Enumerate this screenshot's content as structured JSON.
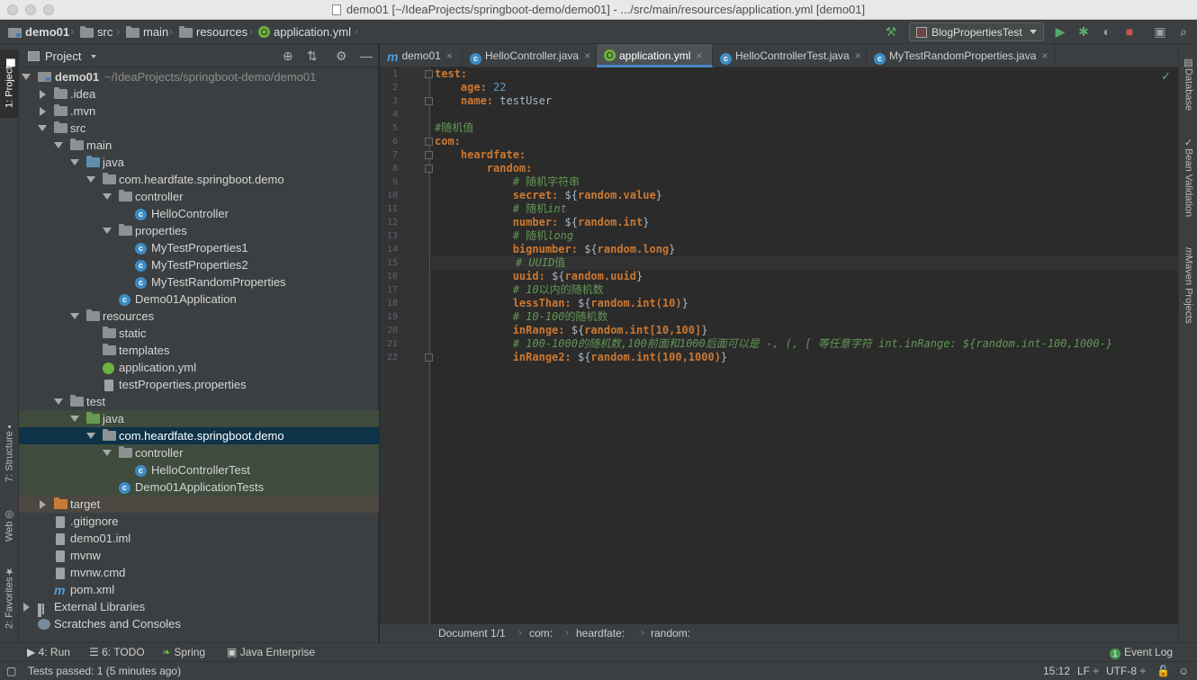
{
  "window": {
    "title": "demo01 [~/IdeaProjects/springboot-demo/demo01] - .../src/main/resources/application.yml [demo01]"
  },
  "navbar": {
    "crumbs": [
      "demo01",
      "src",
      "main",
      "resources",
      "application.yml"
    ],
    "run_config": "BlogPropertiesTest"
  },
  "left_strip": {
    "tabs": [
      "1: Project",
      "7: Structure",
      "Web",
      "2: Favorites"
    ]
  },
  "right_strip": {
    "tabs": [
      "Database",
      "Bean Validation",
      "Maven Projects"
    ]
  },
  "project_panel": {
    "title": "Project",
    "tree": [
      {
        "label": "demo01",
        "path": "~/IdeaProjects/springboot-demo/demo01"
      },
      {
        "label": ".idea"
      },
      {
        "label": ".mvn"
      },
      {
        "label": "src"
      },
      {
        "label": "main"
      },
      {
        "label": "java"
      },
      {
        "label": "com.heardfate.springboot.demo"
      },
      {
        "label": "controller"
      },
      {
        "label": "HelloController"
      },
      {
        "label": "properties"
      },
      {
        "label": "MyTestProperties1"
      },
      {
        "label": "MyTestProperties2"
      },
      {
        "label": "MyTestRandomProperties"
      },
      {
        "label": "Demo01Application"
      },
      {
        "label": "resources"
      },
      {
        "label": "static"
      },
      {
        "label": "templates"
      },
      {
        "label": "application.yml"
      },
      {
        "label": "testProperties.properties"
      },
      {
        "label": "test"
      },
      {
        "label": "java"
      },
      {
        "label": "com.heardfate.springboot.demo"
      },
      {
        "label": "controller"
      },
      {
        "label": "HelloControllerTest"
      },
      {
        "label": "Demo01ApplicationTests"
      },
      {
        "label": "target"
      },
      {
        "label": ".gitignore"
      },
      {
        "label": "demo01.iml"
      },
      {
        "label": "mvnw"
      },
      {
        "label": "mvnw.cmd"
      },
      {
        "label": "pom.xml"
      },
      {
        "label": "External Libraries"
      },
      {
        "label": "Scratches and Consoles"
      }
    ]
  },
  "editor": {
    "tabs": [
      "demo01",
      "HelloController.java",
      "application.yml",
      "HelloControllerTest.java",
      "MyTestRandomProperties.java"
    ],
    "line_numbers": [
      "1",
      "2",
      "3",
      "4",
      "5",
      "6",
      "7",
      "8",
      "9",
      "10",
      "11",
      "12",
      "13",
      "14",
      "15",
      "16",
      "17",
      "18",
      "19",
      "20",
      "21",
      "22"
    ],
    "code": {
      "l1_key": "test:",
      "l2_key": "age:",
      "l2_val": "22",
      "l3_key": "name:",
      "l3_val": "testUser",
      "l5_comment": "#随机值",
      "l6_key": "com:",
      "l7_key": "heardfate:",
      "l8_key": "random:",
      "l9_comment": "# 随机字符串",
      "l10_key": "secret:",
      "l10_val": "random.value",
      "l11_comment_a": "# 随机",
      "l11_comment_b": "int",
      "l12_key": "number:",
      "l12_val": "random.int",
      "l13_comment_a": "# 随机",
      "l13_comment_b": "long",
      "l14_key": "bignumber:",
      "l14_val": "random.long",
      "l15_comment_a": "# ",
      "l15_comment_b": "UUID",
      "l15_comment_c": "值",
      "l16_key": "uuid:",
      "l16_val": "random.uuid",
      "l17_comment_a": "# ",
      "l17_comment_b": "10",
      "l17_comment_c": "以内的随机数",
      "l18_key": "lessThan:",
      "l18_val": "random.int(10)",
      "l19_comment_a": "# ",
      "l19_comment_b": "10-100",
      "l19_comment_c": "的随机数",
      "l20_key": "inRange:",
      "l20_val": "random.int[10,100]",
      "l21_comment": "# 100-1000的随机数,100前面和1000后面可以是 -, (, [ 等任意字符 int.inRange: ${random.int-100,1000-}",
      "l22_key": "inRange2:",
      "l22_val": "random.int(100,1000)",
      "placeholder_open": "${",
      "placeholder_close": "}"
    },
    "breadcrumb": [
      "Document 1/1",
      "com:",
      "heardfate:",
      "random:"
    ]
  },
  "toolwindows": {
    "run": "4: Run",
    "todo": "6: TODO",
    "spring": "Spring",
    "java_enterprise": "Java Enterprise",
    "event_log": "Event Log",
    "event_count": "1"
  },
  "status": {
    "message": "Tests passed: 1 (5 minutes ago)",
    "position": "15:12",
    "line_sep": "LF",
    "encoding": "UTF-8"
  }
}
